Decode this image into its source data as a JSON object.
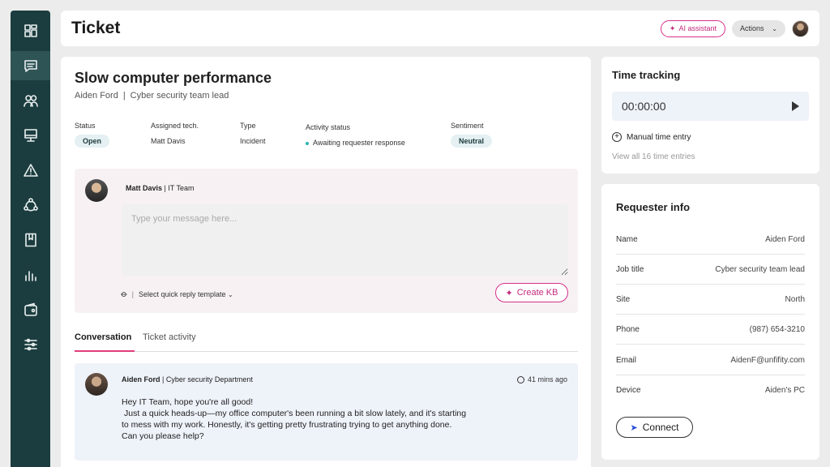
{
  "header": {
    "title": "Ticket",
    "ai_label": "AI assistant",
    "actions_label": "Actions"
  },
  "sidebar": {
    "items": [
      {
        "icon": "dashboard-icon"
      },
      {
        "icon": "tickets-icon"
      },
      {
        "icon": "users-icon"
      },
      {
        "icon": "devices-icon"
      },
      {
        "icon": "alerts-icon"
      },
      {
        "icon": "integrations-icon"
      },
      {
        "icon": "knowledge-icon"
      },
      {
        "icon": "reports-icon"
      },
      {
        "icon": "billing-icon"
      },
      {
        "icon": "settings-icon"
      }
    ]
  },
  "ticket": {
    "title": "Slow computer performance",
    "requester": "Aiden Ford",
    "separator": "|",
    "role": "Cyber security team lead",
    "meta": {
      "status_label": "Status",
      "status_value": "Open",
      "tech_label": "Assigned tech.",
      "tech_value": "Matt Davis",
      "type_label": "Type",
      "type_value": "Incident",
      "activity_label": "Activity status",
      "activity_value": "Awaiting requester response",
      "sentiment_label": "Sentiment",
      "sentiment_value": "Neutral"
    }
  },
  "reply": {
    "author": "Matt Davis",
    "team": "| IT Team",
    "placeholder": "Type your message here...",
    "template_label": "Select quick reply template",
    "create_kb_label": "Create KB"
  },
  "tabs": {
    "conversation": "Conversation",
    "activity": "Ticket activity"
  },
  "message": {
    "author": "Aiden Ford",
    "department": "| Cyber security Department",
    "time": "41 mins ago",
    "line1": "Hey IT Team, hope you're all good!",
    "line2": "Just a quick heads-up—my office computer's been running a bit slow lately, and it's starting",
    "line3": "to mess with my work. Honestly, it's getting pretty frustrating trying to get anything done.",
    "line4": "Can you please help?"
  },
  "time_tracking": {
    "title": "Time tracking",
    "timer": "00:00:00",
    "manual_label": "Manual time entry",
    "view_all": "View all 16 time entries"
  },
  "requester_info": {
    "title": "Requester info",
    "rows": [
      {
        "key": "Name",
        "value": "Aiden Ford"
      },
      {
        "key": "Job title",
        "value": "Cyber security team lead"
      },
      {
        "key": "Site",
        "value": "North"
      },
      {
        "key": "Phone",
        "value": "(987) 654-3210"
      },
      {
        "key": "Email",
        "value": "AidenF@unfifity.com"
      },
      {
        "key": "Device",
        "value": "Aiden's PC"
      }
    ],
    "connect_label": "Connect"
  },
  "colors": {
    "sidebar": "#1b3d3f",
    "accent_pink": "#d6308a",
    "tab_underline": "#e23c7c"
  }
}
